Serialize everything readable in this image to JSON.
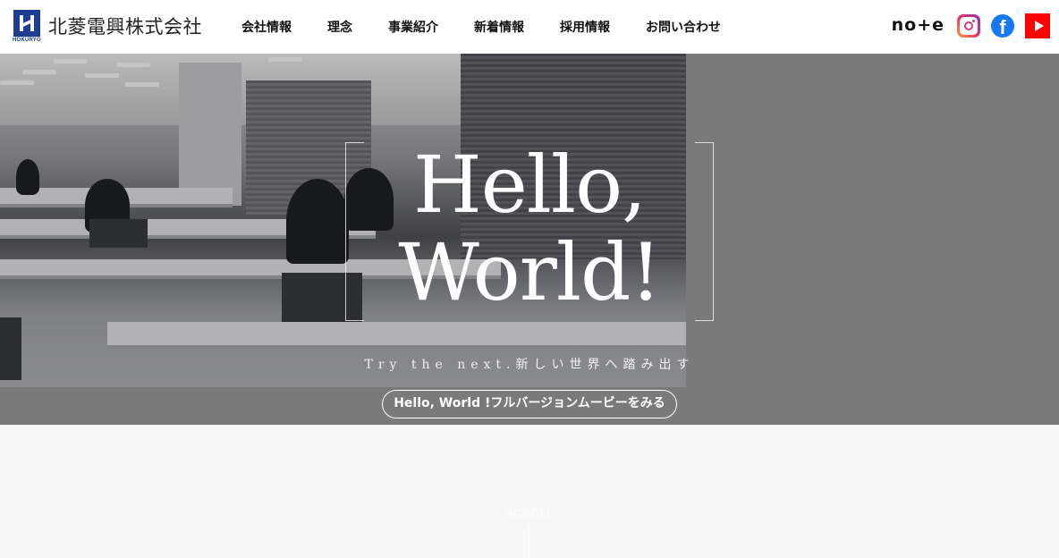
{
  "header": {
    "logo_text": "北菱電興株式会社",
    "logo_sub": "HOKURYO",
    "nav": [
      "会社情報",
      "理念",
      "事業紹介",
      "新着情報",
      "採用情報",
      "お問い合わせ"
    ],
    "social": {
      "note_label": "no+e",
      "facebook_glyph": "f"
    }
  },
  "hero": {
    "line1": "Hello,",
    "line2": "World!",
    "tagline": "Try the next.新しい世界へ踏み出す",
    "cta": "Hello, World !フルバージョンムービーをみる"
  },
  "scroll": {
    "label": "SCROLL"
  },
  "colors": {
    "brand": "#1c3f94",
    "hero_bg": "#7a7a7a",
    "youtube": "#ff0000",
    "facebook": "#1877f2"
  }
}
